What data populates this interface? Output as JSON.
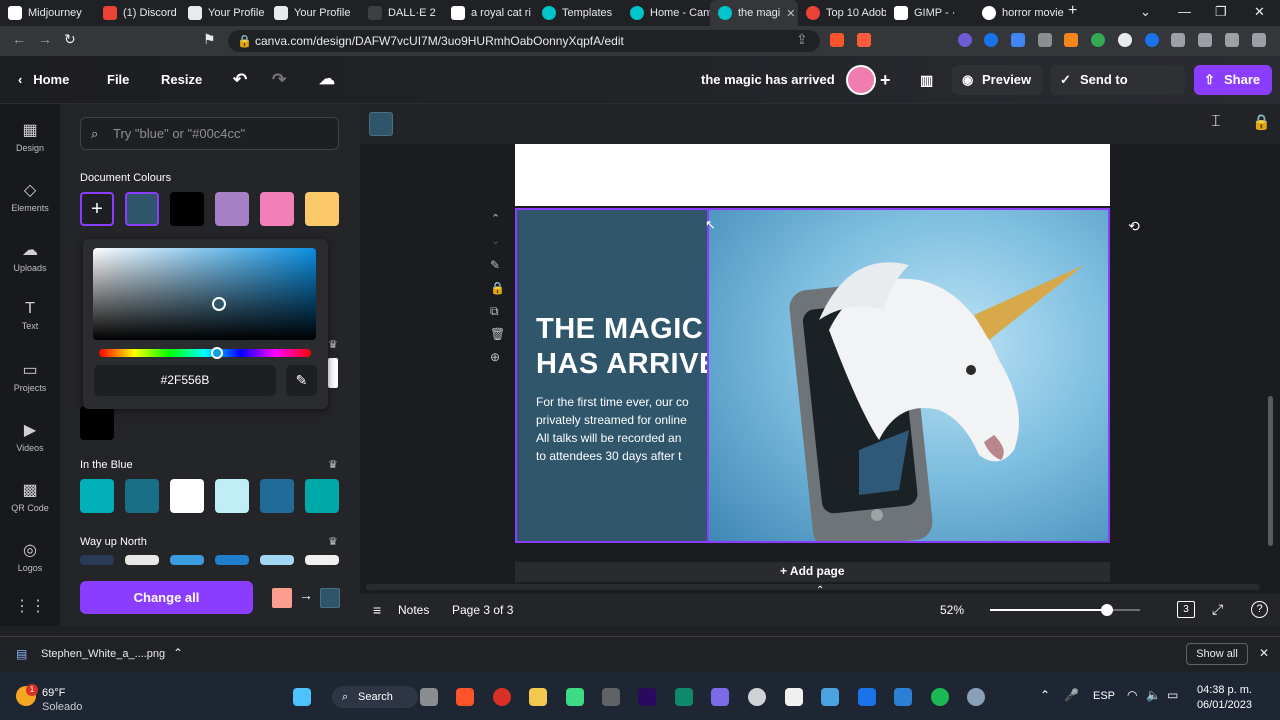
{
  "browser": {
    "tabs": [
      {
        "title": "Midjourney",
        "color": "#ffffff"
      },
      {
        "title": "(1) Discord |",
        "color": "#5865f2"
      },
      {
        "title": "Your Profile",
        "color": "#e8eaed"
      },
      {
        "title": "Your Profile",
        "color": "#e8eaed"
      },
      {
        "title": "DALL·E 2",
        "color": "#303134"
      },
      {
        "title": "a royal cat ri",
        "color": "#ffffff"
      },
      {
        "title": "Templates",
        "color": "#00c4cc"
      },
      {
        "title": "Home - Canv",
        "color": "#00c4cc"
      },
      {
        "title": "the magi",
        "color": "#00c4cc"
      },
      {
        "title": "Top 10 Adob",
        "color": "#ea4335"
      },
      {
        "title": "GIMP - ·",
        "color": "#ffffff"
      },
      {
        "title": "horror movie",
        "color": "#ea4335"
      }
    ],
    "url": "canva.com/design/DAFW7vcUI7M/3uo9HURmhOabOonnyXqpfA/edit"
  },
  "header": {
    "home": "Home",
    "file": "File",
    "resize": "Resize",
    "doc_title": "the magic has arrived",
    "preview": "Preview",
    "send": "Send to Teacher",
    "share": "Share"
  },
  "rail": [
    {
      "label": "Design",
      "icon": "▦"
    },
    {
      "label": "Elements",
      "icon": "◇"
    },
    {
      "label": "Uploads",
      "icon": "☁"
    },
    {
      "label": "Text",
      "icon": "T"
    },
    {
      "label": "Projects",
      "icon": "▭"
    },
    {
      "label": "Videos",
      "icon": "▶"
    },
    {
      "label": "QR Code",
      "icon": "▩"
    },
    {
      "label": "Logos",
      "icon": "◎"
    }
  ],
  "panel": {
    "search_placeholder": "Try \"blue\" or \"#00c4cc\"",
    "doc_colours_title": "Document Colours",
    "doc_colours": [
      "#2f556b",
      "#000000",
      "#a67fc4",
      "#f27fb7",
      "#fbc96a"
    ],
    "extra_swatch": "#000000",
    "hex_value": "#2F556B",
    "palette1_title": "In the Blue",
    "palette1": [
      "#00b0b8",
      "#196f88",
      "#ffffff",
      "#bfeef7",
      "#216b99",
      "#00a9a9"
    ],
    "palette2_title": "Way up North",
    "palette2": [
      "#2a3b55",
      "#e8e8e8",
      "#3a9de0",
      "#1f7fcc",
      "#a3d7f5",
      "#f0f0f0"
    ],
    "change_all": "Change all",
    "change_from": "#fc9e8f",
    "change_to": "#2f556b"
  },
  "slide": {
    "title_line1": "THE MAGIC",
    "title_line2": "HAS ARRIVE",
    "body_lines": [
      "For the first time ever, our co",
      "privately streamed for online",
      "All talks will be recorded an",
      "to attendees 30 days after t"
    ],
    "add_page": "+ Add page"
  },
  "footer": {
    "notes": "Notes",
    "page_info": "Page 3 of 3",
    "zoom": "52%",
    "zoom_fraction": 0.78,
    "page_count": "3"
  },
  "downloads": {
    "file": "Stephen_White_a_....png",
    "show_all": "Show all"
  },
  "taskbar": {
    "weather_temp": "69°F",
    "weather_desc": "Soleado",
    "search": "Search",
    "lang": "ESP",
    "time": "04:38 p. m.",
    "date": "06/01/2023",
    "notif": "1"
  },
  "colors": {
    "accent": "#8b3dff",
    "slide_bg": "#2f556b"
  }
}
